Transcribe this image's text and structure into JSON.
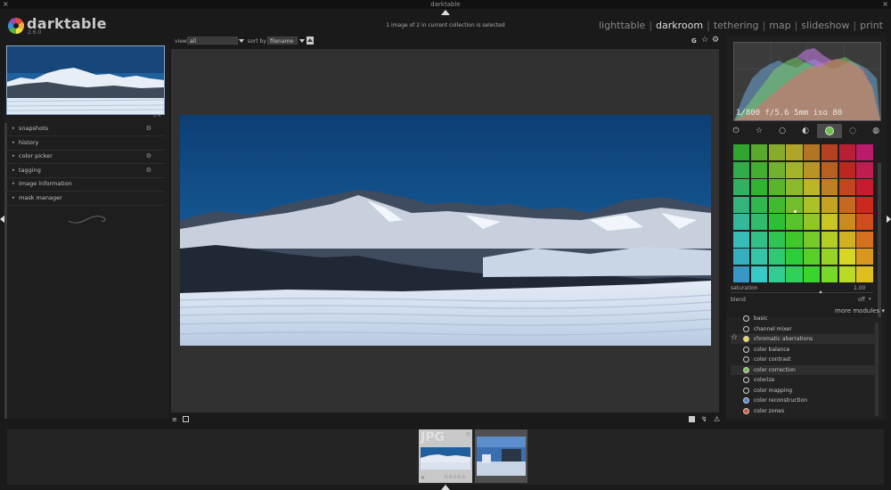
{
  "window": {
    "title": "darktable",
    "close_glyph": "×"
  },
  "header": {
    "app_name": "darktable",
    "version": "2.6.0",
    "selection_info": "1 image of 2 in current collection is selected",
    "views": [
      {
        "label": "lighttable",
        "active": false
      },
      {
        "label": "darkroom",
        "active": true
      },
      {
        "label": "tethering",
        "active": false
      },
      {
        "label": "map",
        "active": false
      },
      {
        "label": "slideshow",
        "active": false
      },
      {
        "label": "print",
        "active": false
      }
    ],
    "view_separator": "|"
  },
  "left_panel": {
    "items": [
      {
        "label": "snapshots",
        "has_gear": true
      },
      {
        "label": "history",
        "has_gear": false
      },
      {
        "label": "color picker",
        "has_gear": true
      },
      {
        "label": "tagging",
        "has_gear": true
      },
      {
        "label": "image information",
        "has_gear": false
      },
      {
        "label": "mask manager",
        "has_gear": false
      }
    ],
    "expander_glyph": "▸",
    "gear_glyph": "⚙"
  },
  "center_toolbar": {
    "view_label": "view",
    "view_value": "all",
    "sort_label": "sort by",
    "sort_value": "filename",
    "grouping_glyph": "G",
    "star_glyph": "☆",
    "gear_glyph": "⚙"
  },
  "center_bottom": {
    "quick_presets_glyph": "≡",
    "styles_glyph": "⊿"
  },
  "right_panel": {
    "exif_line": "1/800 f/5.6 5mm iso 80",
    "module_group_icons": [
      "power-icon",
      "star-icon",
      "circle-icon",
      "half-circle-icon",
      "color-icon",
      "shape-icon",
      "effect-icon"
    ],
    "saturation_label": "saturation",
    "saturation_value": "1.00",
    "blend_label": "blend",
    "blend_value": "off",
    "more_modules_label": "more modules",
    "module_list": [
      {
        "label": "basic",
        "icon_color": "",
        "favorite": false
      },
      {
        "label": "channel mixer",
        "icon_color": "",
        "favorite": false
      },
      {
        "label": "chromatic aberrations",
        "icon_color": "#e8d84a",
        "favorite": true
      },
      {
        "label": "color balance",
        "icon_color": "",
        "favorite": false
      },
      {
        "label": "color contrast",
        "icon_color": "",
        "favorite": false
      },
      {
        "label": "color correction",
        "icon_color": "#7bbf5a",
        "favorite": false
      },
      {
        "label": "colorize",
        "icon_color": "",
        "favorite": false
      },
      {
        "label": "color mapping",
        "icon_color": "",
        "favorite": false
      },
      {
        "label": "color reconstruction",
        "icon_color": "#4a8ad0",
        "favorite": false
      },
      {
        "label": "color zones",
        "icon_color": "#d05a3a",
        "favorite": false
      }
    ]
  },
  "filmstrip": {
    "thumb1_label": "JPG",
    "thumb1_stars": "☆☆☆☆☆",
    "thumb1_reject": "×"
  },
  "colors": {
    "accent": "#1f6fb0",
    "panel": "#1e1e1e",
    "center": "#313131"
  }
}
